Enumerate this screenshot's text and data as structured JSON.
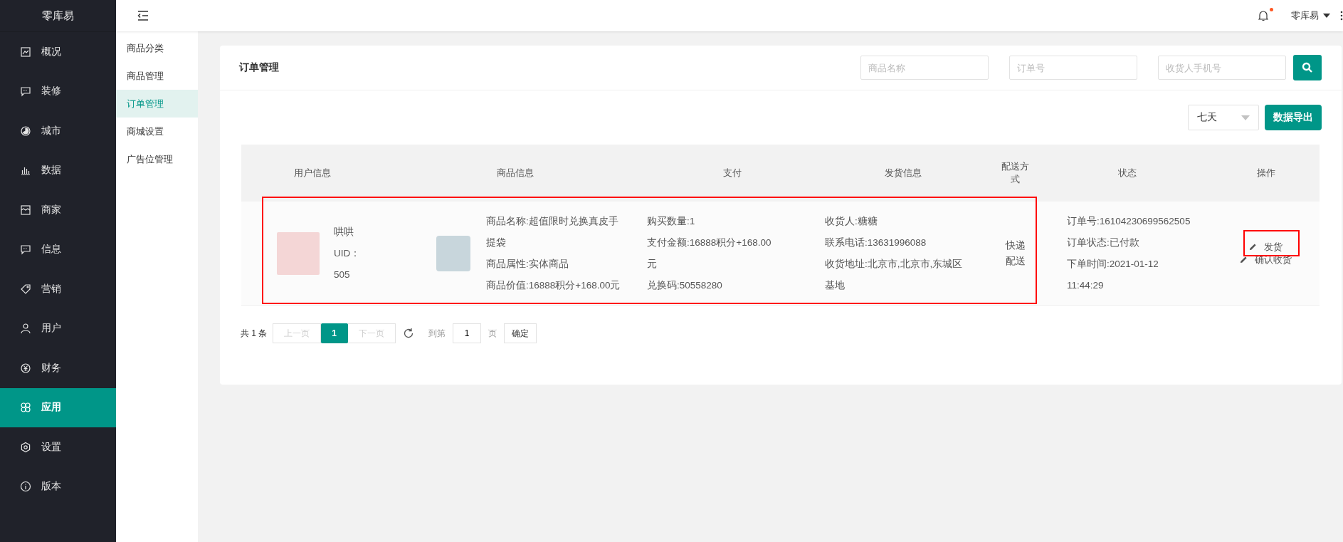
{
  "brand": "零库易",
  "sidebar": {
    "items": [
      {
        "label": "概况",
        "selected": false
      },
      {
        "label": "装修",
        "selected": false
      },
      {
        "label": "城市",
        "selected": false
      },
      {
        "label": "数据",
        "selected": false
      },
      {
        "label": "商家",
        "selected": false
      },
      {
        "label": "信息",
        "selected": false
      },
      {
        "label": "营销",
        "selected": false
      },
      {
        "label": "用户",
        "selected": false
      },
      {
        "label": "财务",
        "selected": false
      },
      {
        "label": "应用",
        "selected": true
      },
      {
        "label": "设置",
        "selected": false
      },
      {
        "label": "版本",
        "selected": false
      }
    ]
  },
  "topbar": {
    "user": "零库易",
    "notification_dot": true
  },
  "submenu": {
    "items": [
      {
        "label": "商品分类",
        "selected": false
      },
      {
        "label": "商品管理",
        "selected": false
      },
      {
        "label": "订单管理",
        "selected": true
      },
      {
        "label": "商城设置",
        "selected": false
      },
      {
        "label": "广告位管理",
        "selected": false
      }
    ]
  },
  "page": {
    "title": "订单管理",
    "filters": [
      {
        "placeholder": "商品名称"
      },
      {
        "placeholder": "订单号"
      },
      {
        "placeholder": "收货人手机号"
      }
    ],
    "period_select": "七天",
    "export_button": "数据导出"
  },
  "table": {
    "columns": [
      "用户信息",
      "商品信息",
      "支付",
      "发货信息",
      "配送方式",
      "状态",
      "操作"
    ],
    "rows": [
      {
        "user_name": "哄哄",
        "uid": "UID：505",
        "goods": [
          "商品名称:超值限时兑换真皮手提袋",
          "商品属性:实体商品",
          "商品价值:16888积分+168.00元"
        ],
        "payment": [
          "购买数量:1",
          "支付金额:16888积分+168.00元",
          "兑换码:50558280"
        ],
        "shipping": [
          "收货人:糖糖",
          "联系电话:13631996088",
          "收货地址:北京市,北京市,东城区基地"
        ],
        "delivery": "快递配送",
        "status": [
          "订单号:16104230699562505",
          "订单状态:已付款",
          "下单时间:2021-01-12 11:44:29"
        ],
        "actions": [
          "发货",
          "确认收货"
        ]
      }
    ]
  },
  "pagination": {
    "total": "共 1 条",
    "prev": "上一页",
    "pages": [
      {
        "label": "1",
        "selected": true
      }
    ],
    "next": "下一页",
    "goto_label": "到第",
    "goto_value": "1",
    "page_unit": "页",
    "confirm": "确定"
  }
}
